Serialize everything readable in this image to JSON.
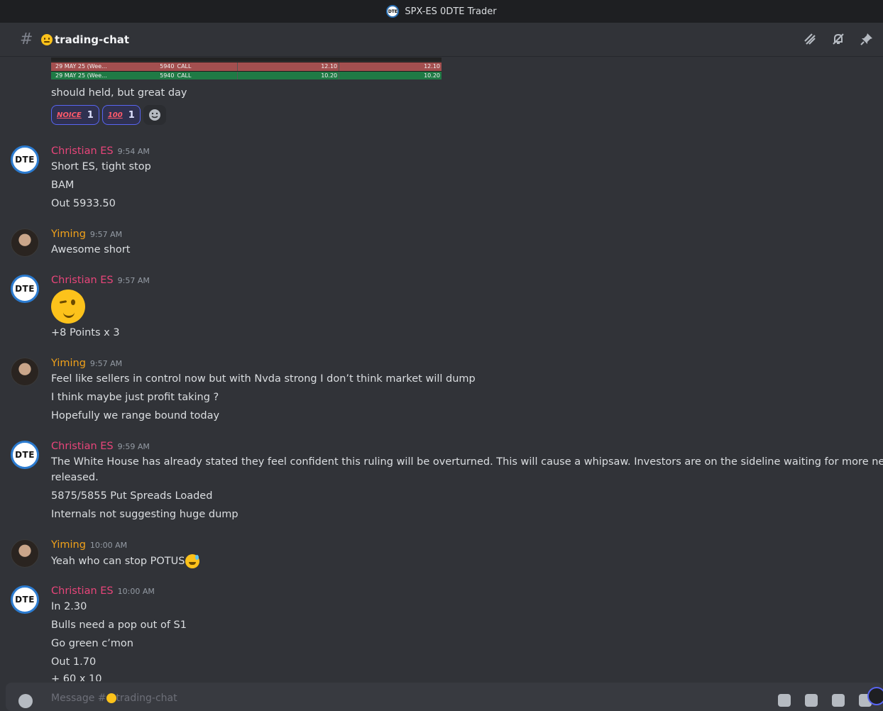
{
  "window": {
    "title": "SPX-ES 0DTE Trader"
  },
  "channel": {
    "name": "trading-chat",
    "emoji_icon": "grinning-face-icon"
  },
  "toolbar": {
    "icons": [
      "threads-icon",
      "notification-mute-icon",
      "pin-icon"
    ]
  },
  "trade_table": {
    "rows": [
      {
        "expiry": "29 MAY 25 (Wee...",
        "strike": "5940",
        "type": "CALL",
        "price": "12.10",
        "avg_price": "12.10",
        "color": "#a34f4f"
      },
      {
        "expiry": "29 MAY 25 (Wee...",
        "strike": "5940",
        "type": "CALL",
        "price": "10.20",
        "avg_price": "10.20",
        "color": "#1f7a45"
      }
    ]
  },
  "first_message_tail": {
    "text": "should held, but great day",
    "reactions": [
      {
        "icon": "noice-icon",
        "label": "NOICE",
        "count": "1"
      },
      {
        "icon": "100-icon",
        "label": "100",
        "count": "1"
      }
    ]
  },
  "messages": [
    {
      "author": "Christian ES",
      "time": "9:54 AM",
      "avatar": "DTE",
      "lines": [
        "Short ES, tight stop",
        "BAM",
        "Out 5933.50"
      ]
    },
    {
      "author": "Yiming",
      "time": "9:57 AM",
      "avatar": "photo",
      "lines": [
        "Awesome short"
      ]
    },
    {
      "author": "Christian ES",
      "time": "9:57 AM",
      "avatar": "DTE",
      "emoji": "winking-face-icon",
      "lines": [
        "+8 Points x 3"
      ]
    },
    {
      "author": "Yiming",
      "time": "9:57 AM",
      "avatar": "photo",
      "lines": [
        "Feel like sellers in control now but with Nvda strong I don’t think market will dump",
        "I think maybe just profit taking ?",
        "Hopefully we range bound today"
      ]
    },
    {
      "author": "Christian ES",
      "time": "9:59 AM",
      "avatar": "DTE",
      "lines": [
        "The White House has already stated they feel confident this ruling will be overturned. This will cause a whipsaw. Investors are on the sideline waiting for more news to be",
        "released.",
        "5875/5855 Put Spreads Loaded",
        "Internals not suggesting huge dump"
      ]
    },
    {
      "author": "Yiming",
      "time": "10:00 AM",
      "avatar": "photo",
      "lines": [
        "Yeah who can stop POTUS"
      ]
    },
    {
      "author": "Christian ES",
      "time": "10:00 AM",
      "avatar": "DTE",
      "lines": [
        "In 2.30",
        "Bulls need a pop out of S1",
        "Go green c’mon",
        "Out 1.70",
        "+ 60 x 10"
      ]
    }
  ],
  "composer": {
    "placeholder_prefix": "Message #",
    "placeholder_suffix": "trading-chat"
  },
  "colors": {
    "christian": "#e8457a",
    "yiming": "#f0a11a",
    "background": "#313338"
  }
}
